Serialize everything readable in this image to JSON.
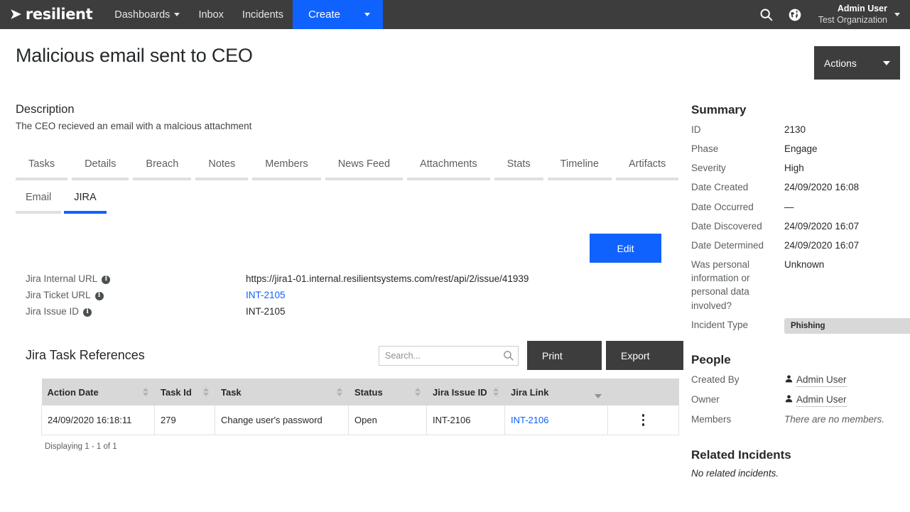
{
  "nav": {
    "brand": "resilient",
    "links": [
      {
        "label": "Dashboards",
        "has_caret": true
      },
      {
        "label": "Inbox",
        "has_caret": false
      },
      {
        "label": "Incidents",
        "has_caret": false
      }
    ],
    "create_label": "Create",
    "search_icon": "search-icon",
    "globe_icon": "globe-icon",
    "user_name": "Admin User",
    "user_org": "Test Organization"
  },
  "header": {
    "title": "Malicious email sent to CEO",
    "actions_label": "Actions"
  },
  "description": {
    "heading": "Description",
    "text": "The CEO recieved an email with a malcious attachment"
  },
  "tabs": [
    {
      "label": "Tasks"
    },
    {
      "label": "Details"
    },
    {
      "label": "Breach"
    },
    {
      "label": "Notes"
    },
    {
      "label": "Members"
    },
    {
      "label": "News Feed"
    },
    {
      "label": "Attachments"
    },
    {
      "label": "Stats"
    },
    {
      "label": "Timeline"
    },
    {
      "label": "Artifacts"
    }
  ],
  "subtabs": [
    {
      "label": "Email",
      "active": false
    },
    {
      "label": "JIRA",
      "active": true
    }
  ],
  "jira": {
    "edit_label": "Edit",
    "fields": [
      {
        "label": "Jira Internal URL",
        "value": "https://jira1-01.internal.resilientsystems.com/rest/api/2/issue/41939",
        "is_link": false
      },
      {
        "label": "Jira Ticket URL",
        "value": "INT-2105",
        "is_link": true
      },
      {
        "label": "Jira Issue ID",
        "value": "INT-2105",
        "is_link": false
      }
    ]
  },
  "table_section": {
    "title": "Jira Task References",
    "search_placeholder": "Search...",
    "search_value": "",
    "print_label": "Print",
    "export_label": "Export",
    "columns": [
      {
        "label": "Action Date",
        "sortable": true
      },
      {
        "label": "Task Id",
        "sortable": true
      },
      {
        "label": "Task",
        "sortable": true
      },
      {
        "label": "Status",
        "sortable": true
      },
      {
        "label": "Jira Issue ID",
        "sortable": true
      },
      {
        "label": "Jira Link",
        "sortable": false
      },
      {
        "label": "",
        "sortable": false
      }
    ],
    "rows": [
      {
        "action_date": "24/09/2020 16:18:11",
        "task_id": "279",
        "task": "Change user's password",
        "status": "Open",
        "jira_issue_id": "INT-2106",
        "jira_link": "INT-2106"
      }
    ],
    "footer": "Displaying 1 - 1 of 1"
  },
  "summary": {
    "heading": "Summary",
    "rows": [
      {
        "label": "ID",
        "value": "2130"
      },
      {
        "label": "Phase",
        "value": "Engage"
      },
      {
        "label": "Severity",
        "value": "High"
      },
      {
        "label": "Date Created",
        "value": "24/09/2020 16:08"
      },
      {
        "label": "Date Occurred",
        "value": "—"
      },
      {
        "label": "Date Discovered",
        "value": "24/09/2020 16:07"
      },
      {
        "label": "Date Determined",
        "value": "24/09/2020 16:07"
      },
      {
        "label": "Was personal information or personal data involved?",
        "value": "Unknown"
      }
    ],
    "incident_type_label": "Incident Type",
    "incident_type_value": "Phishing"
  },
  "people": {
    "heading": "People",
    "created_by_label": "Created By",
    "created_by_value": "Admin User",
    "owner_label": "Owner",
    "owner_value": "Admin User",
    "members_label": "Members",
    "members_value": "There are no members."
  },
  "related": {
    "heading": "Related Incidents",
    "empty_text": "No related incidents."
  },
  "colors": {
    "nav_bg": "#3d3d3d",
    "accent_blue": "#0f62fe",
    "link_blue": "#0f62fe",
    "table_header_bg": "#d8d8d8",
    "badge_bg": "#d8d8d8"
  }
}
